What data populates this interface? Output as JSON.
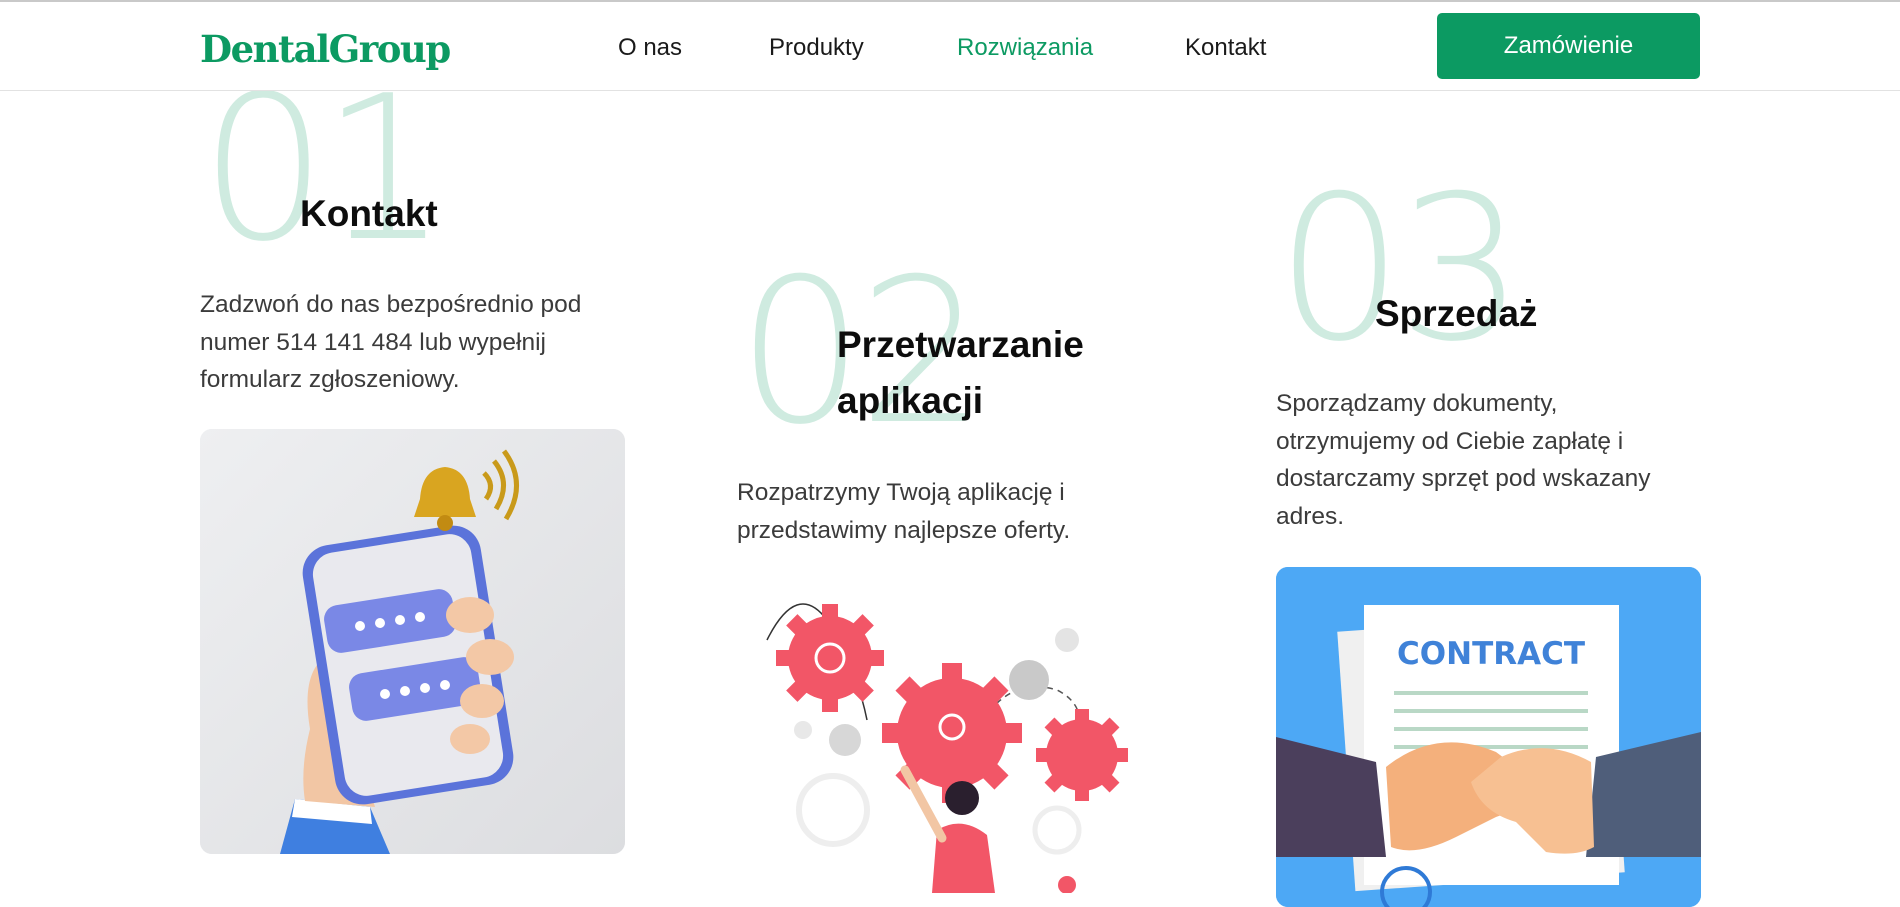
{
  "brand": {
    "name": "DentalGroup"
  },
  "nav": {
    "items": [
      {
        "label": "O nas"
      },
      {
        "label": "Produkty"
      },
      {
        "label": "Rozwiązania"
      },
      {
        "label": "Kontakt"
      }
    ],
    "active_index": 2,
    "cta_label": "Zamówienie"
  },
  "colors": {
    "brand_green": "#0c9a62",
    "number_tint": "#cfebe0",
    "contract_bg": "#4da8f5",
    "gear_red": "#f25667"
  },
  "steps": [
    {
      "number": "01",
      "title": "Kontakt",
      "description": "Zadzwoń do nas bezpośrednio pod numer 514 141 484 lub wypełnij formularz zgłoszeniowy.",
      "image_icon": "phone-chat-bell-illustration"
    },
    {
      "number": "02",
      "title": "Przetwarzanie aplikacji",
      "description": "Rozpatrzymy Twoją aplikację i przedstawimy najlepsze oferty.",
      "image_icon": "gears-person-illustration"
    },
    {
      "number": "03",
      "title": "Sprzedaż",
      "description": "Sporządzamy dokumenty, otrzymujemy od Ciebie zapłatę i dostarczamy sprzęt pod wskazany adres.",
      "image_icon": "contract-handshake-illustration",
      "image_text": "CONTRACT"
    }
  ]
}
